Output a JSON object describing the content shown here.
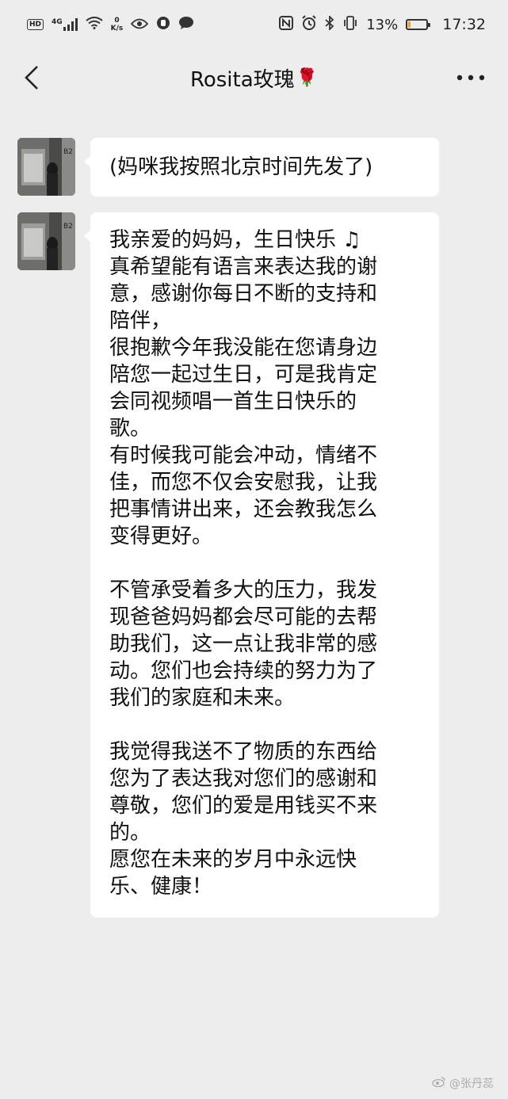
{
  "status_bar": {
    "hd": "HD",
    "network": "4G",
    "speed_value": "0",
    "speed_unit": "K/s",
    "battery_percent": "13%",
    "battery_level": 0.13,
    "time": "17:32"
  },
  "header": {
    "title": "Rosita玫瑰",
    "title_emoji": "🌹"
  },
  "messages": [
    {
      "lines": [
        "(妈咪我按照北京时间先发了)"
      ]
    },
    {
      "lines": [
        "我亲爱的妈妈，生日快乐 ♫",
        "真希望能有语言来表达我的谢",
        "意，感谢你每日不断的支持和",
        "陪伴，",
        "很抱歉今年我没能在您请身边",
        "陪您一起过生日，可是我肯定",
        "会同视频唱一首生日快乐的",
        "歌。",
        "有时候我可能会冲动，情绪不",
        "佳，而您不仅会安慰我，让我",
        "把事情讲出来，还会教我怎么",
        "变得更好。",
        "",
        "不管承受着多大的压力，我发",
        "现爸爸妈妈都会尽可能的去帮",
        "助我们，这一点让我非常的感",
        "动。您们也会持续的努力为了",
        "我们的家庭和未来。",
        "",
        "我觉得我送不了物质的东西给",
        "您为了表达我对您们的感谢和",
        "尊敬，您们的爱是用钱买不来",
        "的。",
        "愿您在未来的岁月中永远快",
        "乐、健康！"
      ]
    }
  ],
  "watermark": "@张丹蕊",
  "colors": {
    "background": "#ededed",
    "bubble": "#ffffff",
    "battery_fill": "#f0a020"
  }
}
